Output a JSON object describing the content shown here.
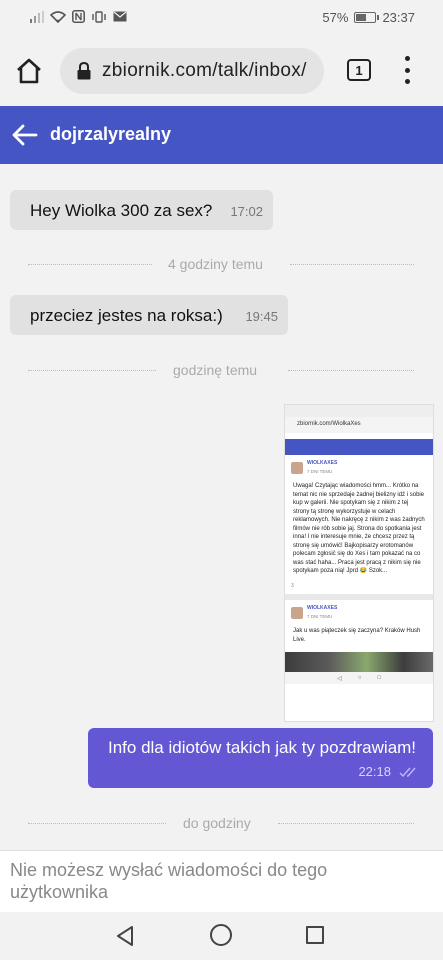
{
  "status_bar": {
    "battery": "57%",
    "time": "23:37",
    "battery_level": 0.57
  },
  "browser": {
    "url": "zbiornik.com/talk/inbox/",
    "tab_count": "1"
  },
  "header": {
    "title": "dojrzalyrealny"
  },
  "messages": [
    {
      "type": "in",
      "text": "Hey Wiolka 300 za sex?",
      "time": "17:02"
    },
    {
      "type": "separator",
      "label": "4 godziny temu"
    },
    {
      "type": "in",
      "text": "przeciez jestes na roksa:)",
      "time": "19:45"
    },
    {
      "type": "separator",
      "label": "godzinę temu"
    },
    {
      "type": "out",
      "text": "Info dla idiotów takich jak ty pozdrawiam!",
      "time": "22:18"
    },
    {
      "type": "separator",
      "label": "do godziny"
    }
  ],
  "attachment": {
    "url": "zbiornik.com/WiolkaXes",
    "post1_user": "WIOLKAXES",
    "post1_meta": "7 DNI TEMU",
    "post1_text": "Uwaga! Czytając wiadomości hmm... Krótko na temat nic nie sprzedaje żadnej bielizny idź i sobie kup w galerii. Nie spotykam się z nikim z tej strony tą stronę wykorzystuje w celach reklamowych. Nie nakręcę z nikim z was żadnych filmów nie rób sobie jaj. Strona do spotkania jest inna! I nie interesuje mnie, że chcesz przez tą stronę się umówić! Bajkopisarzy erotomanów polecam zgłosić się do Xes i tam pokazać na co was stać haha... Praca jest pracą z nikim się nie spotykam poza nią! Jprd 😂 Szok...",
    "post1_likes": "3",
    "post2_user": "WIOLKAXES",
    "post2_meta": "7 DNI TEMU",
    "post2_text": "Jak u was piąteczek się zaczyna? Kraków Hush Live."
  },
  "composer": {
    "notice": "Nie możesz wysłać wiadomości do tego użytkownika"
  },
  "colors": {
    "header": "#4655c4",
    "outgoing_bubble": "#6357d3",
    "incoming_bubble": "#e1e1e1"
  }
}
